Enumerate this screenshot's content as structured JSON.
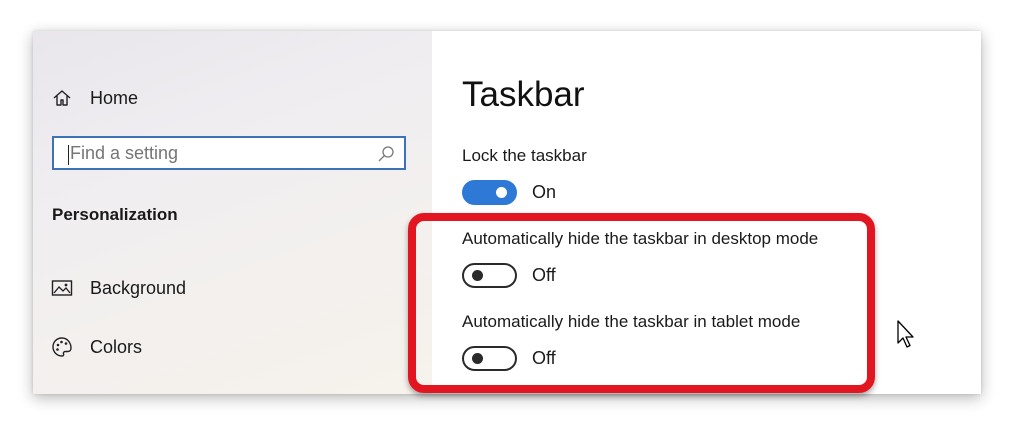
{
  "sidebar": {
    "home_label": "Home",
    "search": {
      "placeholder": "Find a setting"
    },
    "section_heading": "Personalization",
    "items": [
      {
        "label": "Background",
        "icon": "image-icon"
      },
      {
        "label": "Colors",
        "icon": "palette-icon"
      }
    ]
  },
  "main": {
    "title": "Taskbar",
    "settings": [
      {
        "label": "Lock the taskbar",
        "state": "On",
        "on": true
      },
      {
        "label": "Automatically hide the taskbar in desktop mode",
        "state": "Off",
        "on": false
      },
      {
        "label": "Automatically hide the taskbar in tablet mode",
        "state": "Off",
        "on": false
      }
    ]
  },
  "colors": {
    "accent": "#2e78d6",
    "search_border": "#3d72b6",
    "highlight": "#e21620"
  }
}
